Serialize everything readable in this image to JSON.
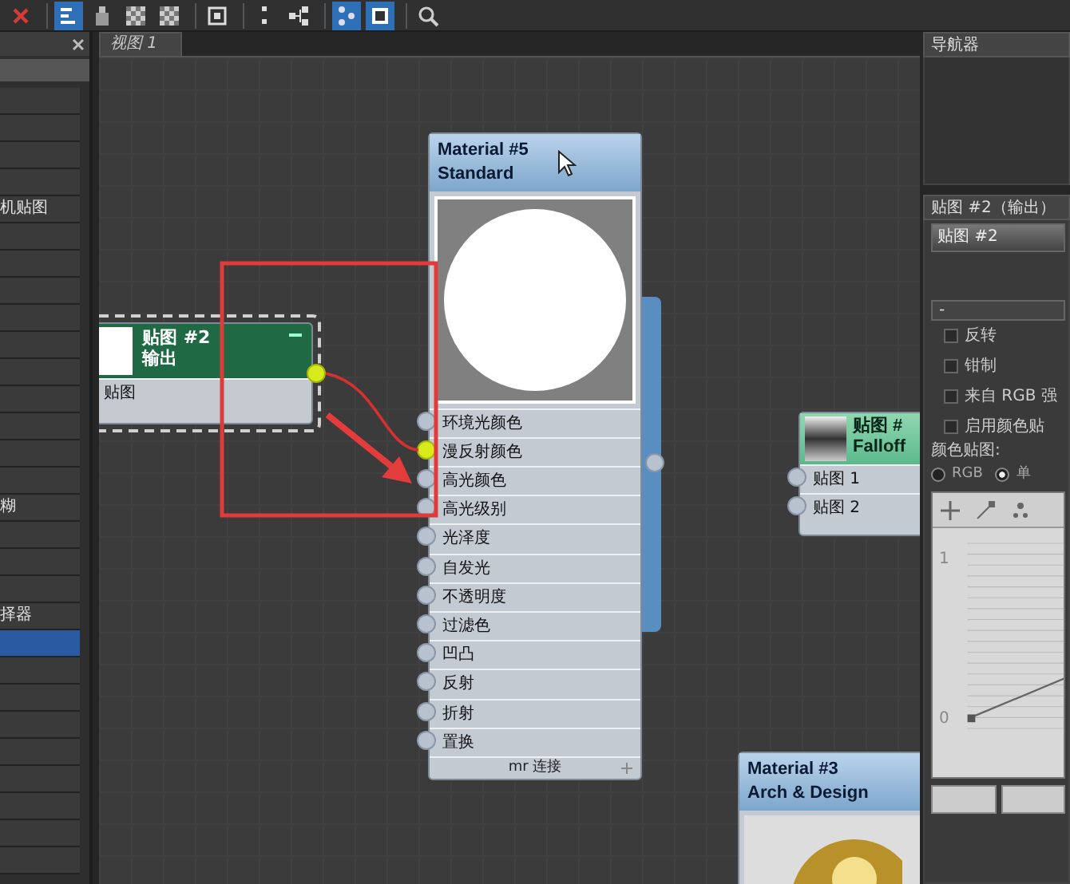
{
  "toolbar": {
    "buttons": [
      {
        "kind": "delete",
        "selected": false
      },
      {
        "kind": "layout",
        "selected": true
      },
      {
        "kind": "pick",
        "selected": false
      },
      {
        "kind": "checker",
        "selected": false
      },
      {
        "kind": "checker",
        "selected": false
      },
      {
        "kind": "preview",
        "selected": false
      },
      {
        "kind": "dots",
        "selected": false
      },
      {
        "kind": "tree",
        "selected": false
      },
      {
        "kind": "nodes",
        "selected": true
      },
      {
        "kind": "panel",
        "selected": true
      },
      {
        "kind": "find",
        "selected": false
      }
    ]
  },
  "left_panel": {
    "items": [
      {
        "selected": false
      },
      {
        "selected": false
      },
      {
        "selected": false
      },
      {
        "selected": false
      },
      {
        "label": "机贴图",
        "selected": false
      },
      {
        "selected": false
      },
      {
        "selected": false
      },
      {
        "selected": false
      },
      {
        "selected": false
      },
      {
        "selected": false
      },
      {
        "selected": false
      },
      {
        "selected": false
      },
      {
        "selected": false
      },
      {
        "selected": false
      },
      {
        "selected": false
      },
      {
        "label": "糊",
        "selected": false
      },
      {
        "selected": false
      },
      {
        "selected": false
      },
      {
        "selected": false
      },
      {
        "label": "择器",
        "selected": false
      },
      {
        "selected": true
      },
      {
        "selected": false
      },
      {
        "selected": false
      },
      {
        "selected": false
      },
      {
        "selected": false
      },
      {
        "selected": false
      },
      {
        "selected": false
      },
      {
        "selected": false
      },
      {
        "selected": false
      }
    ]
  },
  "view_tab": {
    "label": "视图 1",
    "selected": true
  },
  "nodes": {
    "material_5": {
      "title": "Material #5",
      "subtitle": "Standard",
      "slots": [
        {
          "label": "环境光颜色",
          "connected": false
        },
        {
          "label": "漫反射颜色",
          "connected": true
        },
        {
          "label": "高光颜色",
          "connected": false
        },
        {
          "label": "高光级别",
          "connected": false
        },
        {
          "label": "光泽度",
          "connected": false
        },
        {
          "label": "自发光",
          "connected": false
        },
        {
          "label": "不透明度",
          "connected": false
        },
        {
          "label": "过滤色",
          "connected": false
        },
        {
          "label": "凹凸",
          "connected": false
        },
        {
          "label": "反射",
          "connected": false
        },
        {
          "label": "折射",
          "connected": false
        },
        {
          "label": "置换",
          "connected": false
        }
      ],
      "footer": "mr 连接"
    },
    "map_2": {
      "title": "贴图 #2",
      "subtitle": "输出",
      "selected": true,
      "slots": [
        {
          "label": "贴图"
        }
      ]
    },
    "falloff": {
      "title": "贴图 #",
      "subtitle": "Falloff",
      "slots": [
        {
          "label": "贴图 1"
        },
        {
          "label": "贴图 2"
        }
      ]
    },
    "material_3": {
      "title": "Material #3",
      "subtitle": "Arch & Design"
    }
  },
  "navigator": {
    "title": "导航器"
  },
  "parameters": {
    "title": "贴图 #2（输出）",
    "name_field": "贴图 #2",
    "rollout": "-",
    "checkboxes": [
      {
        "label": "反转",
        "checked": false
      },
      {
        "label": "钳制",
        "checked": false
      },
      {
        "label": "来自 RGB 强",
        "checked": false
      },
      {
        "label": "启用颜色贴",
        "checked": false
      }
    ],
    "color_map_label": "颜色贴图:",
    "radios": [
      {
        "label": "RGB",
        "selected": false
      },
      {
        "label": "单",
        "selected": true
      }
    ],
    "curve": {
      "y_labels": [
        "1",
        "0"
      ]
    }
  }
}
